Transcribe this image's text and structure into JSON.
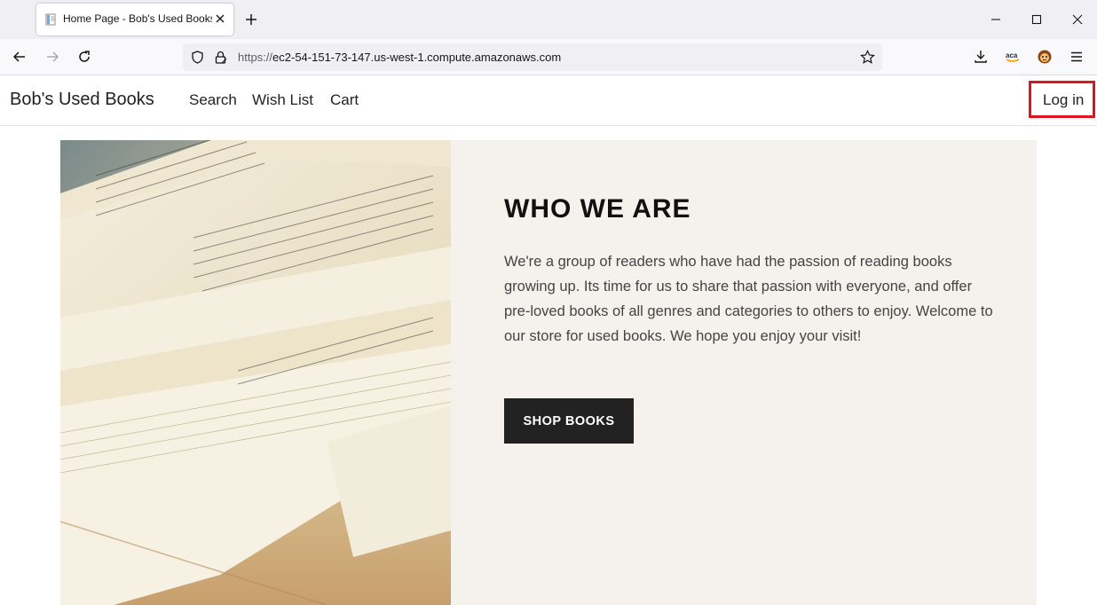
{
  "browser": {
    "tab": {
      "title": "Home Page - Bob's Used Books"
    },
    "url": {
      "scheme": "https://",
      "host": "ec2-54-151-73-147.us-west-1.compute.amazonaws.com"
    },
    "icons": {
      "back": "back-arrow-icon",
      "forward": "forward-arrow-icon",
      "reload": "reload-icon",
      "shield": "tracking-shield-icon",
      "lock": "lock-icon",
      "bookmark": "bookmark-star-icon",
      "downloads": "download-icon",
      "extension_amazon": "amazon-extension-icon",
      "extension_monkey": "monkey-extension-icon",
      "menu": "hamburger-menu-icon"
    }
  },
  "site": {
    "brand": "Bob's Used Books",
    "nav": [
      "Search",
      "Wish List",
      "Cart"
    ],
    "login": "Log in",
    "login_highlight_color": "#e0141e"
  },
  "hero": {
    "heading": "WHO WE ARE",
    "body": "We're a group of readers who have had the passion of reading books growing up. Its time for us to share that passion with everyone, and offer pre-loved books of all genres and categories to others to enjoy. Welcome to our store for used books. We hope you enjoy your visit!",
    "button": "SHOP BOOKS",
    "image": "open-book-photo",
    "panel_color": "#f5f2ee",
    "button_color": "#222222"
  }
}
